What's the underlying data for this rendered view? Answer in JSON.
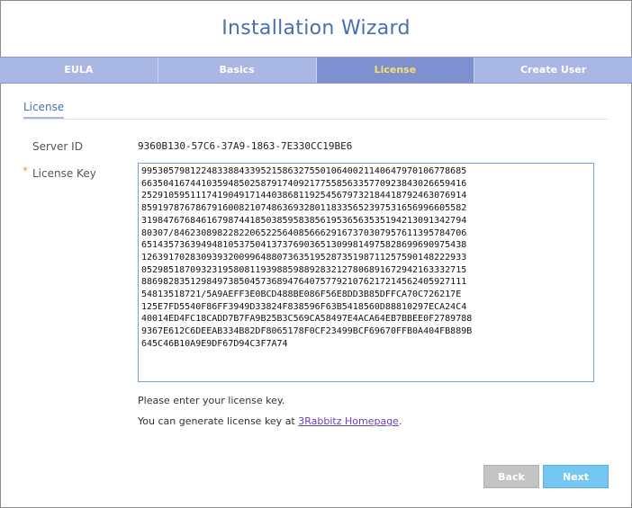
{
  "window": {
    "title": "Installation Wizard"
  },
  "tabs": [
    {
      "label": "EULA",
      "active": false
    },
    {
      "label": "Basics",
      "active": false
    },
    {
      "label": "License",
      "active": true
    },
    {
      "label": "Create User",
      "active": false
    }
  ],
  "section": {
    "title": "License"
  },
  "server_id": {
    "label": "Server ID",
    "value": "9360B130-57C6-37A9-1863-7E330CC19BE6"
  },
  "license_key": {
    "label": "License Key",
    "required_mark": "*",
    "value": "995305798122483388433952158632755010640021140647970106778685\n663504167441035948502587917409217755856335770923843026659416\n252910595111741904917144038681192545679732184418792463076914\n859197876786791600821074863693280118335652397531656996605582\n319847676846167987441850385958385619536563535194213091342794\n80307/846230898228220652256408566629167370307957611395784706\n651435736394948105375041373769036513099814975828699690975438\n126391702830939320099648807363519528735198711257590148222933\n052985187093231958081193988598892832127806891672942163332715\n886982835129849738504573689476407577921076217214562405927111\n54813518721/5A9AEFF3E0BCD488BE086F56E8DD3B85DFFCA70C726217E\n125E7FD5540F86FF3949D33824F838596F63B5418560D88810297ECA24C4\n40014ED4FC18CADD7B7FA9B25B3C569CA58497E4ACA64EB7BBEE0F2789788\n9367E612C6DEEAB334B82DF8065178F0CF23499BCF69670FFB0A404FB889B\n645C46B10A9E9DF67D94C3F7A74"
  },
  "hints": {
    "enter_key": "Please enter your license key.",
    "generate_prefix": "You can generate license key at ",
    "generate_link": "3Rabbitz Homepage",
    "generate_suffix": "."
  },
  "buttons": {
    "back": "Back",
    "next": "Next"
  },
  "colors": {
    "title": "#4a6fb0",
    "tab_bar": "#a9b7e4",
    "tab_active": "#7e90cf",
    "tab_active_text": "#f7e36a",
    "next_button": "#74c7f0",
    "back_button": "#c4c4c4"
  }
}
